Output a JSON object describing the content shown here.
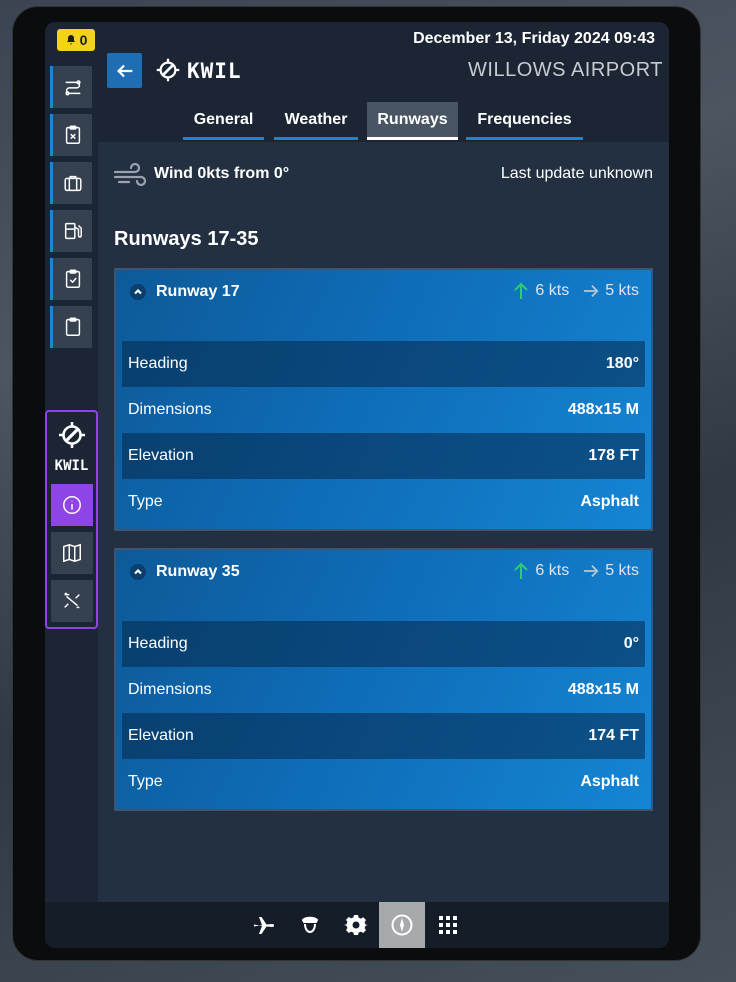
{
  "status": {
    "notification_count": "0",
    "datetime": "December 13, Friday 2024 09:43"
  },
  "sidebar": {
    "items": [
      {
        "icon": "route-settings-icon"
      },
      {
        "icon": "clipboard-x-icon"
      },
      {
        "icon": "briefcase-icon"
      },
      {
        "icon": "fuel-pump-icon"
      },
      {
        "icon": "clipboard-check-icon"
      },
      {
        "icon": "clipboard-icon"
      }
    ],
    "airport_panel": {
      "code": "KWIL",
      "buttons": [
        {
          "icon": "info-icon",
          "active": true
        },
        {
          "icon": "map-icon",
          "active": false
        },
        {
          "icon": "route-icon",
          "active": false
        }
      ]
    }
  },
  "header": {
    "ident": "KWIL",
    "airport_name": "WILLOWS AIRPORT"
  },
  "tabs": [
    {
      "label": "General",
      "active": false
    },
    {
      "label": "Weather",
      "active": false
    },
    {
      "label": "Runways",
      "active": true
    },
    {
      "label": "Frequencies",
      "active": false
    }
  ],
  "wind": {
    "summary": "Wind 0kts from 0°",
    "last_update": "Last update unknown"
  },
  "section_title": "Runways 17-35",
  "runways": [
    {
      "title": "Runway 17",
      "headwind": "6 kts",
      "crosswind": "5 kts",
      "rows": [
        {
          "label": "Heading",
          "value": "180°"
        },
        {
          "label": "Dimensions",
          "value": "488x15 M"
        },
        {
          "label": "Elevation",
          "value": "178 FT"
        },
        {
          "label": "Type",
          "value": "Asphalt"
        }
      ]
    },
    {
      "title": "Runway 35",
      "headwind": "6 kts",
      "crosswind": "5 kts",
      "rows": [
        {
          "label": "Heading",
          "value": "0°"
        },
        {
          "label": "Dimensions",
          "value": "488x15 M"
        },
        {
          "label": "Elevation",
          "value": "174 FT"
        },
        {
          "label": "Type",
          "value": "Asphalt"
        }
      ]
    }
  ],
  "bottom_bar": [
    {
      "icon": "airplane-icon",
      "active": false
    },
    {
      "icon": "pilot-icon",
      "active": false
    },
    {
      "icon": "gear-icon",
      "active": false
    },
    {
      "icon": "compass-icon",
      "active": true
    },
    {
      "icon": "grid-icon",
      "active": false
    }
  ],
  "colors": {
    "accent": "#1c86d6",
    "airport_accent": "#8e44e6",
    "badge": "#f3d31a",
    "headwind": "#2ecc71"
  }
}
